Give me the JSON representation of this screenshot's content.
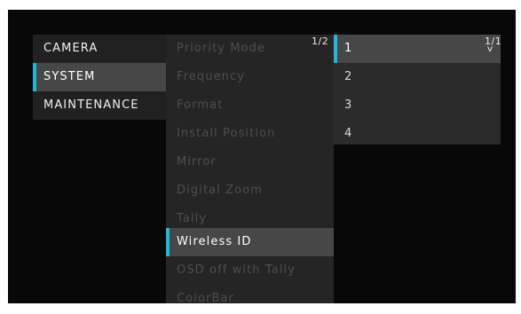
{
  "colors": {
    "background": "#080808",
    "main_menu_bg": "#212121",
    "sub_menu_bg": "#252525",
    "value_list_bg": "#2b2b2b",
    "selected_bg": "#474747",
    "accent": "#22b7d9",
    "active_text": "#f0f0f0",
    "dimmed_text": "#4e4e4e"
  },
  "main_menu": {
    "items": [
      {
        "label": "CAMERA",
        "selected": false
      },
      {
        "label": "SYSTEM",
        "selected": true
      },
      {
        "label": "MAINTENANCE",
        "selected": false
      }
    ]
  },
  "sub_menu": {
    "page_indicator": "1/2",
    "items": [
      {
        "label": "Priority Mode",
        "selected": false
      },
      {
        "label": "Frequency",
        "selected": false
      },
      {
        "label": "Format",
        "selected": false
      },
      {
        "label": "Install Position",
        "selected": false
      },
      {
        "label": "Mirror",
        "selected": false
      },
      {
        "label": "Digital Zoom",
        "selected": false
      },
      {
        "label": "Tally",
        "selected": false
      },
      {
        "label": "Wireless ID",
        "selected": true
      },
      {
        "label": "OSD off with Tally",
        "selected": false
      },
      {
        "label": "ColorBar",
        "selected": false
      }
    ]
  },
  "value_list": {
    "page_indicator": "1/1",
    "scroll_icon": "chevron-down-icon",
    "scroll_glyph": "v",
    "items": [
      {
        "label": "1",
        "selected": true
      },
      {
        "label": "2",
        "selected": false
      },
      {
        "label": "3",
        "selected": false
      },
      {
        "label": "4",
        "selected": false
      }
    ]
  }
}
